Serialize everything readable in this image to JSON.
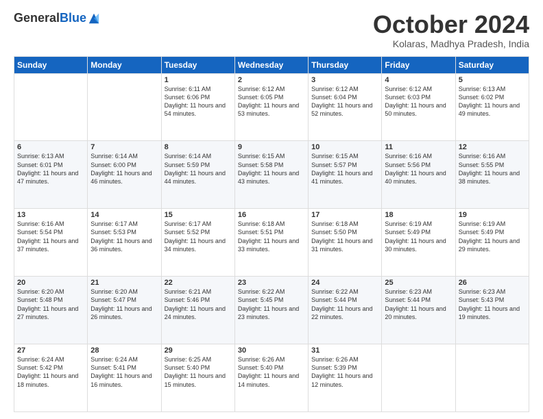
{
  "logo": {
    "general": "General",
    "blue": "Blue"
  },
  "title": "October 2024",
  "subtitle": "Kolaras, Madhya Pradesh, India",
  "days": [
    "Sunday",
    "Monday",
    "Tuesday",
    "Wednesday",
    "Thursday",
    "Friday",
    "Saturday"
  ],
  "weeks": [
    [
      {
        "day": "",
        "content": ""
      },
      {
        "day": "",
        "content": ""
      },
      {
        "day": "1",
        "content": "Sunrise: 6:11 AM\nSunset: 6:06 PM\nDaylight: 11 hours and 54 minutes."
      },
      {
        "day": "2",
        "content": "Sunrise: 6:12 AM\nSunset: 6:05 PM\nDaylight: 11 hours and 53 minutes."
      },
      {
        "day": "3",
        "content": "Sunrise: 6:12 AM\nSunset: 6:04 PM\nDaylight: 11 hours and 52 minutes."
      },
      {
        "day": "4",
        "content": "Sunrise: 6:12 AM\nSunset: 6:03 PM\nDaylight: 11 hours and 50 minutes."
      },
      {
        "day": "5",
        "content": "Sunrise: 6:13 AM\nSunset: 6:02 PM\nDaylight: 11 hours and 49 minutes."
      }
    ],
    [
      {
        "day": "6",
        "content": "Sunrise: 6:13 AM\nSunset: 6:01 PM\nDaylight: 11 hours and 47 minutes."
      },
      {
        "day": "7",
        "content": "Sunrise: 6:14 AM\nSunset: 6:00 PM\nDaylight: 11 hours and 46 minutes."
      },
      {
        "day": "8",
        "content": "Sunrise: 6:14 AM\nSunset: 5:59 PM\nDaylight: 11 hours and 44 minutes."
      },
      {
        "day": "9",
        "content": "Sunrise: 6:15 AM\nSunset: 5:58 PM\nDaylight: 11 hours and 43 minutes."
      },
      {
        "day": "10",
        "content": "Sunrise: 6:15 AM\nSunset: 5:57 PM\nDaylight: 11 hours and 41 minutes."
      },
      {
        "day": "11",
        "content": "Sunrise: 6:16 AM\nSunset: 5:56 PM\nDaylight: 11 hours and 40 minutes."
      },
      {
        "day": "12",
        "content": "Sunrise: 6:16 AM\nSunset: 5:55 PM\nDaylight: 11 hours and 38 minutes."
      }
    ],
    [
      {
        "day": "13",
        "content": "Sunrise: 6:16 AM\nSunset: 5:54 PM\nDaylight: 11 hours and 37 minutes."
      },
      {
        "day": "14",
        "content": "Sunrise: 6:17 AM\nSunset: 5:53 PM\nDaylight: 11 hours and 36 minutes."
      },
      {
        "day": "15",
        "content": "Sunrise: 6:17 AM\nSunset: 5:52 PM\nDaylight: 11 hours and 34 minutes."
      },
      {
        "day": "16",
        "content": "Sunrise: 6:18 AM\nSunset: 5:51 PM\nDaylight: 11 hours and 33 minutes."
      },
      {
        "day": "17",
        "content": "Sunrise: 6:18 AM\nSunset: 5:50 PM\nDaylight: 11 hours and 31 minutes."
      },
      {
        "day": "18",
        "content": "Sunrise: 6:19 AM\nSunset: 5:49 PM\nDaylight: 11 hours and 30 minutes."
      },
      {
        "day": "19",
        "content": "Sunrise: 6:19 AM\nSunset: 5:49 PM\nDaylight: 11 hours and 29 minutes."
      }
    ],
    [
      {
        "day": "20",
        "content": "Sunrise: 6:20 AM\nSunset: 5:48 PM\nDaylight: 11 hours and 27 minutes."
      },
      {
        "day": "21",
        "content": "Sunrise: 6:20 AM\nSunset: 5:47 PM\nDaylight: 11 hours and 26 minutes."
      },
      {
        "day": "22",
        "content": "Sunrise: 6:21 AM\nSunset: 5:46 PM\nDaylight: 11 hours and 24 minutes."
      },
      {
        "day": "23",
        "content": "Sunrise: 6:22 AM\nSunset: 5:45 PM\nDaylight: 11 hours and 23 minutes."
      },
      {
        "day": "24",
        "content": "Sunrise: 6:22 AM\nSunset: 5:44 PM\nDaylight: 11 hours and 22 minutes."
      },
      {
        "day": "25",
        "content": "Sunrise: 6:23 AM\nSunset: 5:44 PM\nDaylight: 11 hours and 20 minutes."
      },
      {
        "day": "26",
        "content": "Sunrise: 6:23 AM\nSunset: 5:43 PM\nDaylight: 11 hours and 19 minutes."
      }
    ],
    [
      {
        "day": "27",
        "content": "Sunrise: 6:24 AM\nSunset: 5:42 PM\nDaylight: 11 hours and 18 minutes."
      },
      {
        "day": "28",
        "content": "Sunrise: 6:24 AM\nSunset: 5:41 PM\nDaylight: 11 hours and 16 minutes."
      },
      {
        "day": "29",
        "content": "Sunrise: 6:25 AM\nSunset: 5:40 PM\nDaylight: 11 hours and 15 minutes."
      },
      {
        "day": "30",
        "content": "Sunrise: 6:26 AM\nSunset: 5:40 PM\nDaylight: 11 hours and 14 minutes."
      },
      {
        "day": "31",
        "content": "Sunrise: 6:26 AM\nSunset: 5:39 PM\nDaylight: 11 hours and 12 minutes."
      },
      {
        "day": "",
        "content": ""
      },
      {
        "day": "",
        "content": ""
      }
    ]
  ]
}
